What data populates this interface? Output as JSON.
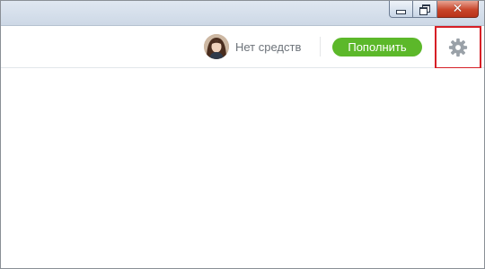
{
  "window": {
    "close_glyph": "✕"
  },
  "header": {
    "balance_label": "Нет средств",
    "topup_label": "Пополнить"
  },
  "icons": {
    "minimize": "minimize-icon",
    "maximize": "restore-icon",
    "close": "close-icon",
    "settings": "gear-icon",
    "avatar": "user-avatar"
  },
  "colors": {
    "topup_button": "#5cb82a",
    "highlight_frame": "#d61f26",
    "gear": "#9aa1a8",
    "balance_text": "#6d737a",
    "close_button": "#c8452a"
  }
}
